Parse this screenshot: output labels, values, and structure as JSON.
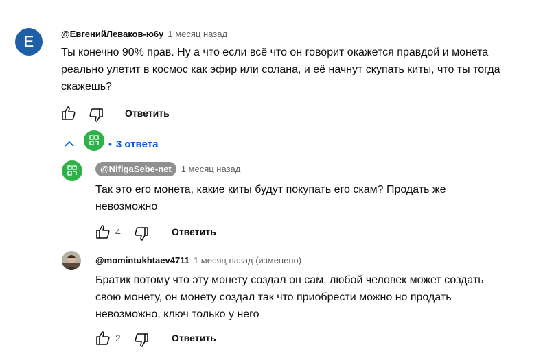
{
  "comment": {
    "avatar_letter": "E",
    "author": "@ЕвгенийЛеваков-ю6у",
    "time": "1 месяц назад",
    "text_lines": [
      "Ты конечно 90% прав. Ну а что если всё что он говорит окажется правдой и монета",
      "реально улетит в космос как эфир или солана, и её начнут скупать киты, что ты тогда",
      "скажешь?"
    ],
    "reply_label": "Ответить"
  },
  "replies_toggle": {
    "label": "3 ответа",
    "separator": "•"
  },
  "replies": [
    {
      "author": "@NifigaSebe-net",
      "time": "1 месяц назад",
      "text_lines": [
        "Так это его монета, какие киты будут покупать его скам? Продать же",
        "невозможно"
      ],
      "likes": "4",
      "reply_label": "Ответить"
    },
    {
      "author": "@momintukhtaev4711",
      "time": "1 месяц назад (изменено)",
      "text_lines": [
        "Братик потому что эту монету создал он сам, любой человек может создать",
        "свою монету, он монету создал так что приобрести можно но продать",
        "невозможно, ключ только у него"
      ],
      "likes": "2",
      "reply_label": "Ответить"
    }
  ],
  "colors": {
    "avatar_blue": "#1f5fa8",
    "avatar_green": "#2fb14a",
    "link_blue": "#065fd4",
    "chip_gray": "#909090"
  }
}
